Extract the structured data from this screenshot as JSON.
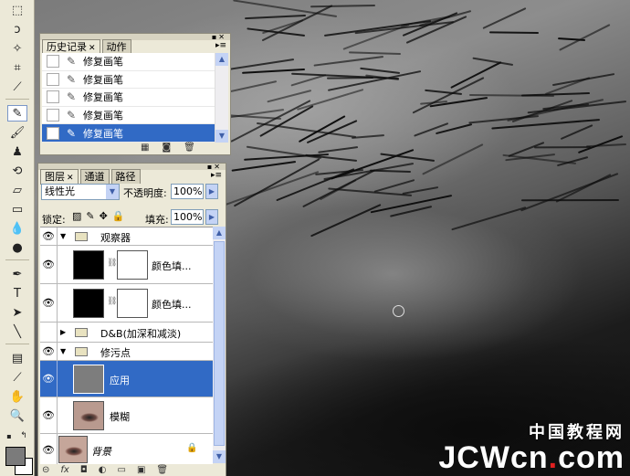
{
  "history_panel": {
    "tabs": [
      "历史记录",
      "动作"
    ],
    "items": [
      {
        "label": "修复画笔",
        "selected": false
      },
      {
        "label": "修复画笔",
        "selected": false
      },
      {
        "label": "修复画笔",
        "selected": false
      },
      {
        "label": "修复画笔",
        "selected": false
      },
      {
        "label": "修复画笔",
        "selected": true
      }
    ]
  },
  "layers_panel": {
    "tabs": [
      "图层",
      "通道",
      "路径"
    ],
    "blend_mode": "线性光",
    "opacity_label": "不透明度:",
    "opacity_value": "100%",
    "lock_label": "锁定:",
    "fill_label": "填充:",
    "fill_value": "100%",
    "layers": [
      {
        "name": "观察器",
        "kind": "group",
        "expanded": true,
        "visible": true
      },
      {
        "name": "颜色填...",
        "kind": "fill",
        "visible": true
      },
      {
        "name": "颜色填...",
        "kind": "fill",
        "visible": true
      },
      {
        "name": "D&B(加深和减淡)",
        "kind": "group",
        "expanded": false,
        "visible": false
      },
      {
        "name": "修污点",
        "kind": "group",
        "expanded": true,
        "visible": true
      },
      {
        "name": "应用",
        "kind": "layer",
        "visible": true,
        "selected": true
      },
      {
        "name": "模糊",
        "kind": "layer",
        "visible": true
      },
      {
        "name": "背景",
        "kind": "background",
        "visible": true
      }
    ]
  },
  "watermark": {
    "cn": "中国教程网",
    "en_main": "JCWcn",
    "en_dot": ".",
    "en_tail": "com"
  },
  "colors": {
    "selection": "#316ac5",
    "panel_bg": "#ece9d8",
    "foreground_swatch": "#7b7b7b",
    "background_swatch": "#ffffff"
  }
}
